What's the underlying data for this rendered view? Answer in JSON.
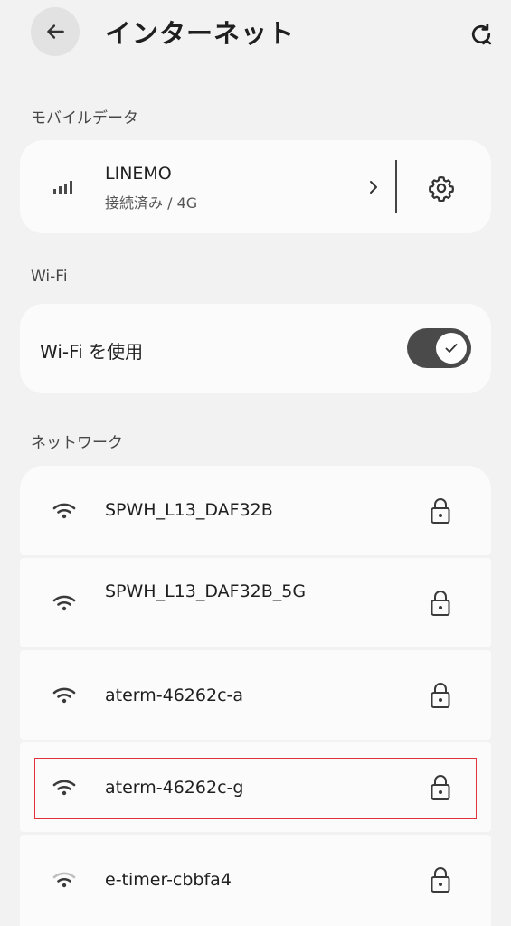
{
  "header": {
    "title": "インターネット",
    "back_icon": "back-arrow-icon",
    "refresh_icon": "refresh-icon"
  },
  "mobile_data": {
    "section_label": "モバイルデータ",
    "carrier": "LINEMO",
    "status": "接続済み / 4G",
    "signal_icon": "cell-signal-icon",
    "chevron_icon": "chevron-right-icon",
    "settings_icon": "gear-icon"
  },
  "wifi": {
    "section_label": "Wi-Fi",
    "toggle_label": "Wi-Fi を使用",
    "enabled": true
  },
  "networks": {
    "section_label": "ネットワーク",
    "items": [
      {
        "name": "SPWH_L13_DAF32B",
        "secured": true
      },
      {
        "name": "SPWH_L13_DAF32B_5G",
        "secured": true
      },
      {
        "name": "aterm-46262c-a",
        "secured": true
      },
      {
        "name": "aterm-46262c-g",
        "secured": true,
        "highlighted": true
      },
      {
        "name": "e-timer-cbbfa4",
        "secured": true
      }
    ]
  },
  "colors": {
    "background": "#f2f2f2",
    "card": "#fbfbfb",
    "toggle_on": "#4a4a4a",
    "highlight": "#e0323a"
  }
}
